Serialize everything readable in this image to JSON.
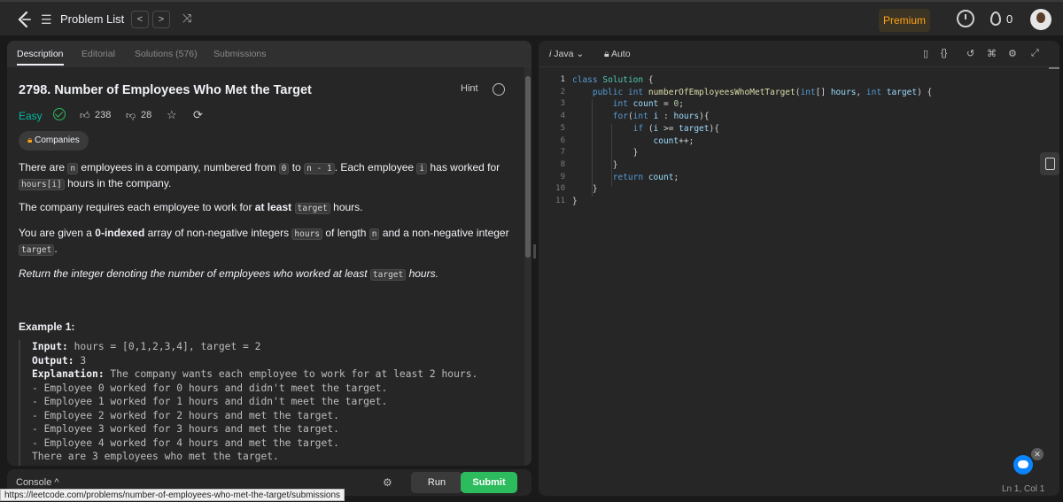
{
  "topnav": {
    "problem_list": "Problem List",
    "prev": "<",
    "next": ">",
    "shuffle": "⤨",
    "premium": "Premium",
    "streak": "0"
  },
  "tabs": [
    "Description",
    "Editorial",
    "Solutions (576)",
    "Submissions"
  ],
  "problem": {
    "title": "2798. Number of Employees Who Met the Target",
    "hint": "Hint",
    "difficulty": "Easy",
    "likes": "238",
    "dislikes": "28",
    "companies": "Companies",
    "p1": {
      "t1": "There are ",
      "c1": "n",
      "t2": " employees in a company, numbered from ",
      "c2": "0",
      "t3": " to ",
      "c3": "n - 1",
      "t4": ". Each employee ",
      "c4": "i",
      "t5": " has worked for ",
      "c5": "hours[i]",
      "t6": " hours in the company."
    },
    "p2": {
      "t1": "The company requires each employee to work for ",
      "b1": "at least",
      "c1": "target",
      "t2": " hours."
    },
    "p3": {
      "t1": "You are given a ",
      "b1": "0-indexed",
      "t2": " array of non-negative integers ",
      "c1": "hours",
      "t3": " of length ",
      "c2": "n",
      "t4": " and a non-negative integer ",
      "c3": "target",
      "t5": "."
    },
    "p4": {
      "t1": "Return the integer denoting the number of employees who worked at least ",
      "c1": "target",
      "t2": " hours."
    },
    "example_title": "Example 1:",
    "example": {
      "input_label": "Input:",
      "input": " hours = [0,1,2,3,4], target = 2",
      "output_label": "Output:",
      "output": " 3",
      "explanation_label": "Explanation:",
      "explanation": " The company wants each employee to work for at least 2 hours.",
      "lines": [
        "- Employee 0 worked for 0 hours and didn't meet the target.",
        "- Employee 1 worked for 1 hours and didn't meet the target.",
        "- Employee 2 worked for 2 hours and met the target.",
        "- Employee 3 worked for 3 hours and met the target.",
        "- Employee 4 worked for 4 hours and met the target.",
        "There are 3 employees who met the target."
      ]
    }
  },
  "console": {
    "label": "Console ^",
    "run": "Run",
    "submit": "Submit"
  },
  "status_url": "https://leetcode.com/problems/number-of-employees-who-met-the-target/submissions",
  "editor": {
    "language": "Java",
    "auto": "Auto",
    "line_numbers": [
      "1",
      "2",
      "3",
      "4",
      "5",
      "6",
      "7",
      "8",
      "9",
      "10",
      "11"
    ],
    "cursor": "Ln 1, Col 1"
  },
  "colors": {
    "accent": "#ffa116",
    "easy": "#00b8a3",
    "submit": "#2cbb5d"
  }
}
